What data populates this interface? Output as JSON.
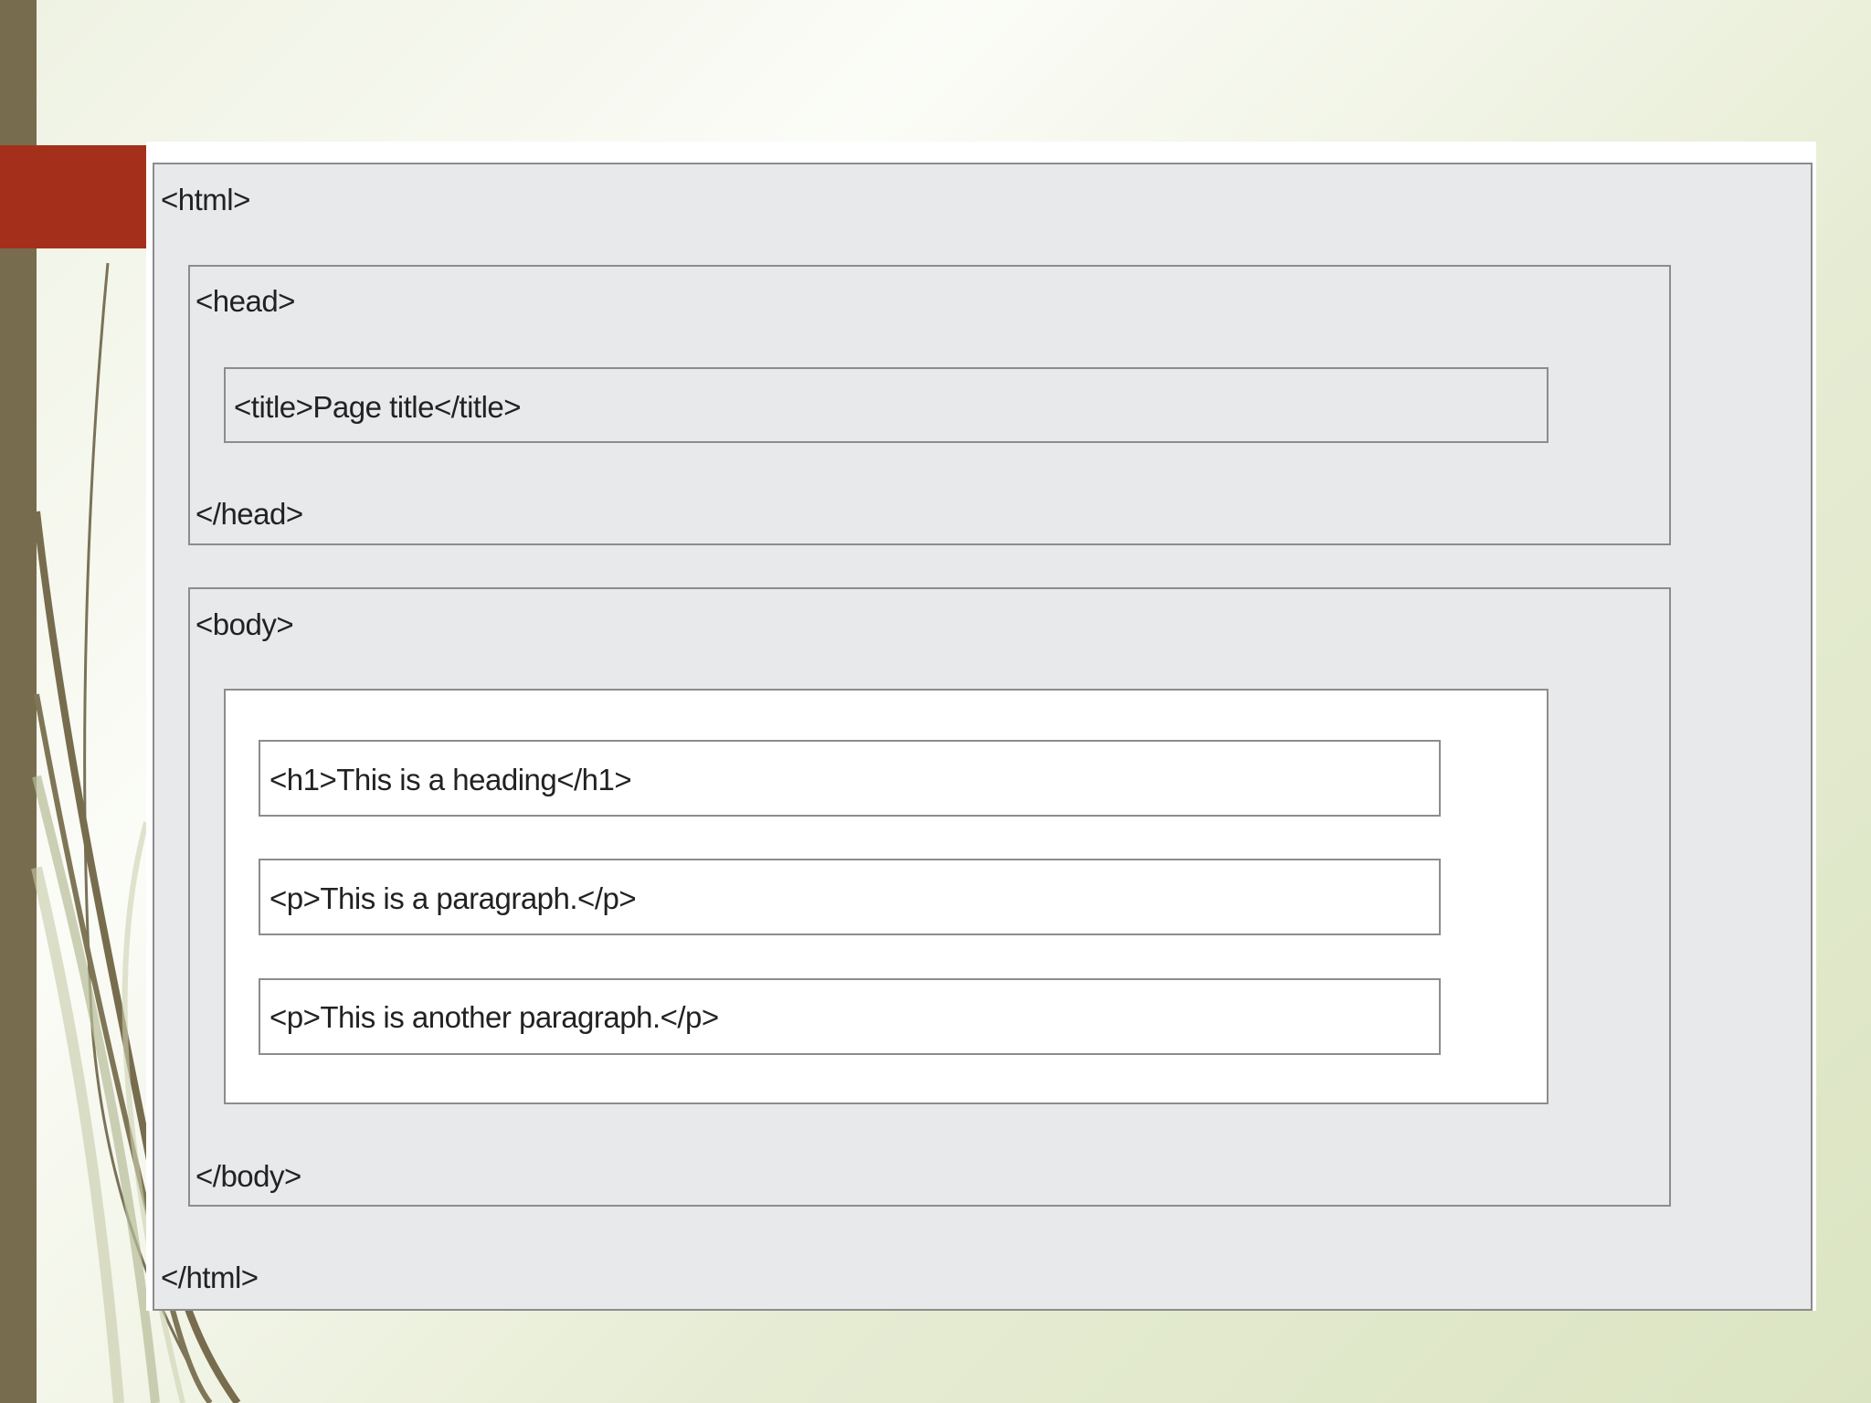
{
  "slide": {
    "colors": {
      "left_bar": "#786c4e",
      "accent_block": "#a4301b",
      "box_fill": "#e8e9eb",
      "box_border": "#8c8c8c"
    }
  },
  "diagram": {
    "html_open": "<html>",
    "head_open": "<head>",
    "title_line": "<title>Page title</title>",
    "head_close": "</head>",
    "body_open": "<body>",
    "h1_line": "<h1>This is a heading</h1>",
    "p1_line": "<p>This is a paragraph.</p>",
    "p2_line": "<p>This is another paragraph.</p>",
    "body_close": "</body>",
    "html_close": "</html>"
  }
}
